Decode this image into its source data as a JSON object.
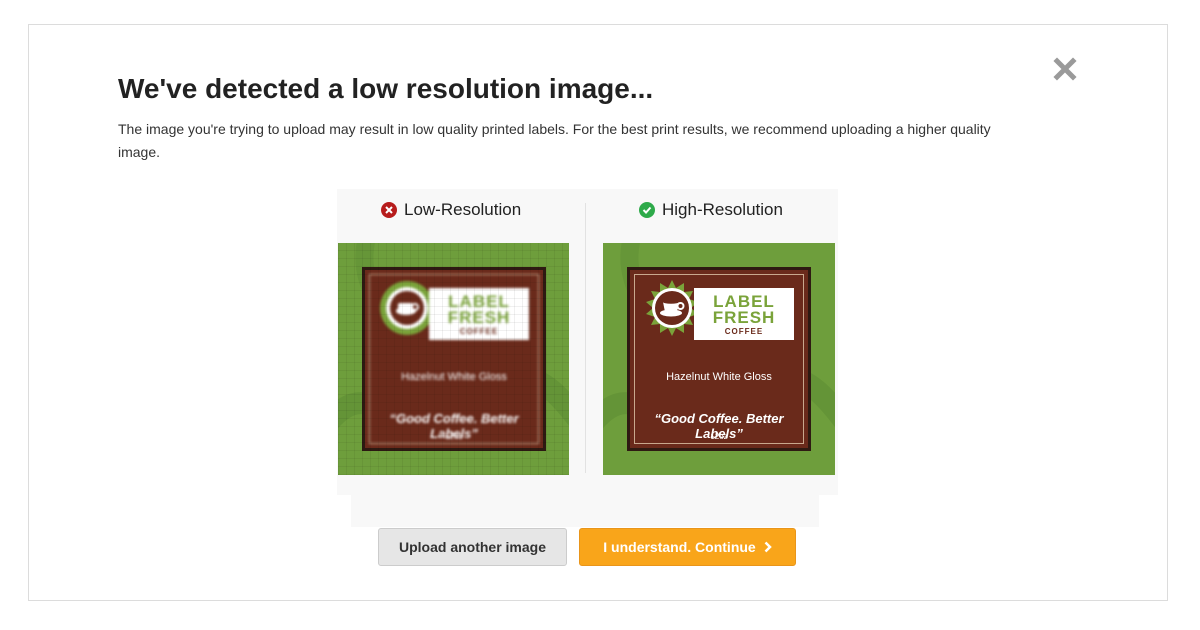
{
  "dialog": {
    "title": "We've detected a low resolution image...",
    "description": "The image you're trying to upload may result in low quality printed labels. For the best print results, we recommend uploading a higher quality image.",
    "close_icon": "close-icon"
  },
  "comparison": {
    "low": {
      "heading": "Low-Resolution",
      "icon": "error-circle-icon",
      "icon_color": "#b71c1c"
    },
    "high": {
      "heading": "High-Resolution",
      "icon": "check-circle-icon",
      "icon_color": "#2eaa4a"
    }
  },
  "label": {
    "brand_line1": "LABEL",
    "brand_line2": "FRESH",
    "brand_line3": "COFFEE",
    "flavor": "Hazelnut White Gloss",
    "tagline": "“Good Coffee. Better Labels”",
    "size": "12oz"
  },
  "actions": {
    "upload_label": "Upload another image",
    "continue_label": "I understand. Continue",
    "continue_icon": "chevron-right-icon"
  },
  "colors": {
    "accent": "#f9a51a",
    "label_green": "#6e9e3c",
    "label_brown": "#6a2a1b"
  }
}
